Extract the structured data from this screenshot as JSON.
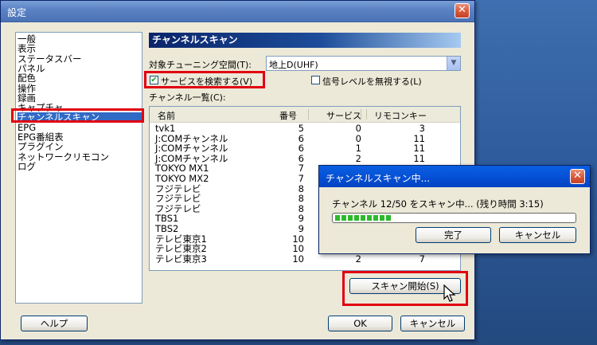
{
  "window": {
    "title": "設定"
  },
  "tree": {
    "items": [
      {
        "label": "一般",
        "selected": false
      },
      {
        "label": "表示",
        "selected": false
      },
      {
        "label": "ステータスバー",
        "selected": false
      },
      {
        "label": "パネル",
        "selected": false
      },
      {
        "label": "配色",
        "selected": false
      },
      {
        "label": "操作",
        "selected": false
      },
      {
        "label": "録画",
        "selected": false
      },
      {
        "label": "キャプチャ",
        "selected": false
      },
      {
        "label": "チャンネルスキャン",
        "selected": true
      },
      {
        "label": "EPG",
        "selected": false
      },
      {
        "label": "EPG番組表",
        "selected": false
      },
      {
        "label": "プラグイン",
        "selected": false
      },
      {
        "label": "ネットワークリモコン",
        "selected": false
      },
      {
        "label": "ログ",
        "selected": false
      }
    ]
  },
  "panel": {
    "header": "チャンネルスキャン",
    "tuning_space_label": "対象チューニング空間(T):",
    "tuning_space_value": "地上D(UHF)",
    "search_services_label": "サービスを検索する(V)",
    "search_services_checked": true,
    "ignore_signal_label": "信号レベルを無視する(L)",
    "ignore_signal_checked": false,
    "channel_list_label": "チャンネル一覧(C):",
    "columns": [
      "名前",
      "番号",
      "サービス",
      "リモコンキー"
    ],
    "rows": [
      {
        "name": "tvk1",
        "number": "5",
        "service": "0",
        "remote": "3"
      },
      {
        "name": "J:COMチャンネル",
        "number": "6",
        "service": "0",
        "remote": "11"
      },
      {
        "name": "J:COMチャンネル",
        "number": "6",
        "service": "1",
        "remote": "11"
      },
      {
        "name": "J:COMチャンネル",
        "number": "6",
        "service": "2",
        "remote": "11"
      },
      {
        "name": "TOKYO MX1",
        "number": "7",
        "service": "",
        "remote": ""
      },
      {
        "name": "TOKYO MX2",
        "number": "7",
        "service": "",
        "remote": ""
      },
      {
        "name": "フジテレビ",
        "number": "8",
        "service": "",
        "remote": ""
      },
      {
        "name": "フジテレビ",
        "number": "8",
        "service": "",
        "remote": ""
      },
      {
        "name": "フジテレビ",
        "number": "8",
        "service": "",
        "remote": ""
      },
      {
        "name": "TBS1",
        "number": "9",
        "service": "",
        "remote": ""
      },
      {
        "name": "TBS2",
        "number": "9",
        "service": "",
        "remote": ""
      },
      {
        "name": "テレビ東京1",
        "number": "10",
        "service": "",
        "remote": ""
      },
      {
        "name": "テレビ東京2",
        "number": "10",
        "service": "",
        "remote": ""
      },
      {
        "name": "テレビ東京3",
        "number": "10",
        "service": "2",
        "remote": "7"
      }
    ],
    "scan_button": "スキャン開始(S)"
  },
  "buttons": {
    "help": "ヘルプ",
    "ok": "OK",
    "cancel": "キャンセル"
  },
  "progress_dialog": {
    "title": "チャンネルスキャン中...",
    "message": "チャンネル 12/50 をスキャン中... (残り時間 3:15)",
    "progress": 0.24,
    "done_button": "完了",
    "cancel_button": "キャンセル"
  },
  "colors": {
    "highlight": "#e10010",
    "selection": "#316ac5",
    "progress": "#2cba2c"
  }
}
